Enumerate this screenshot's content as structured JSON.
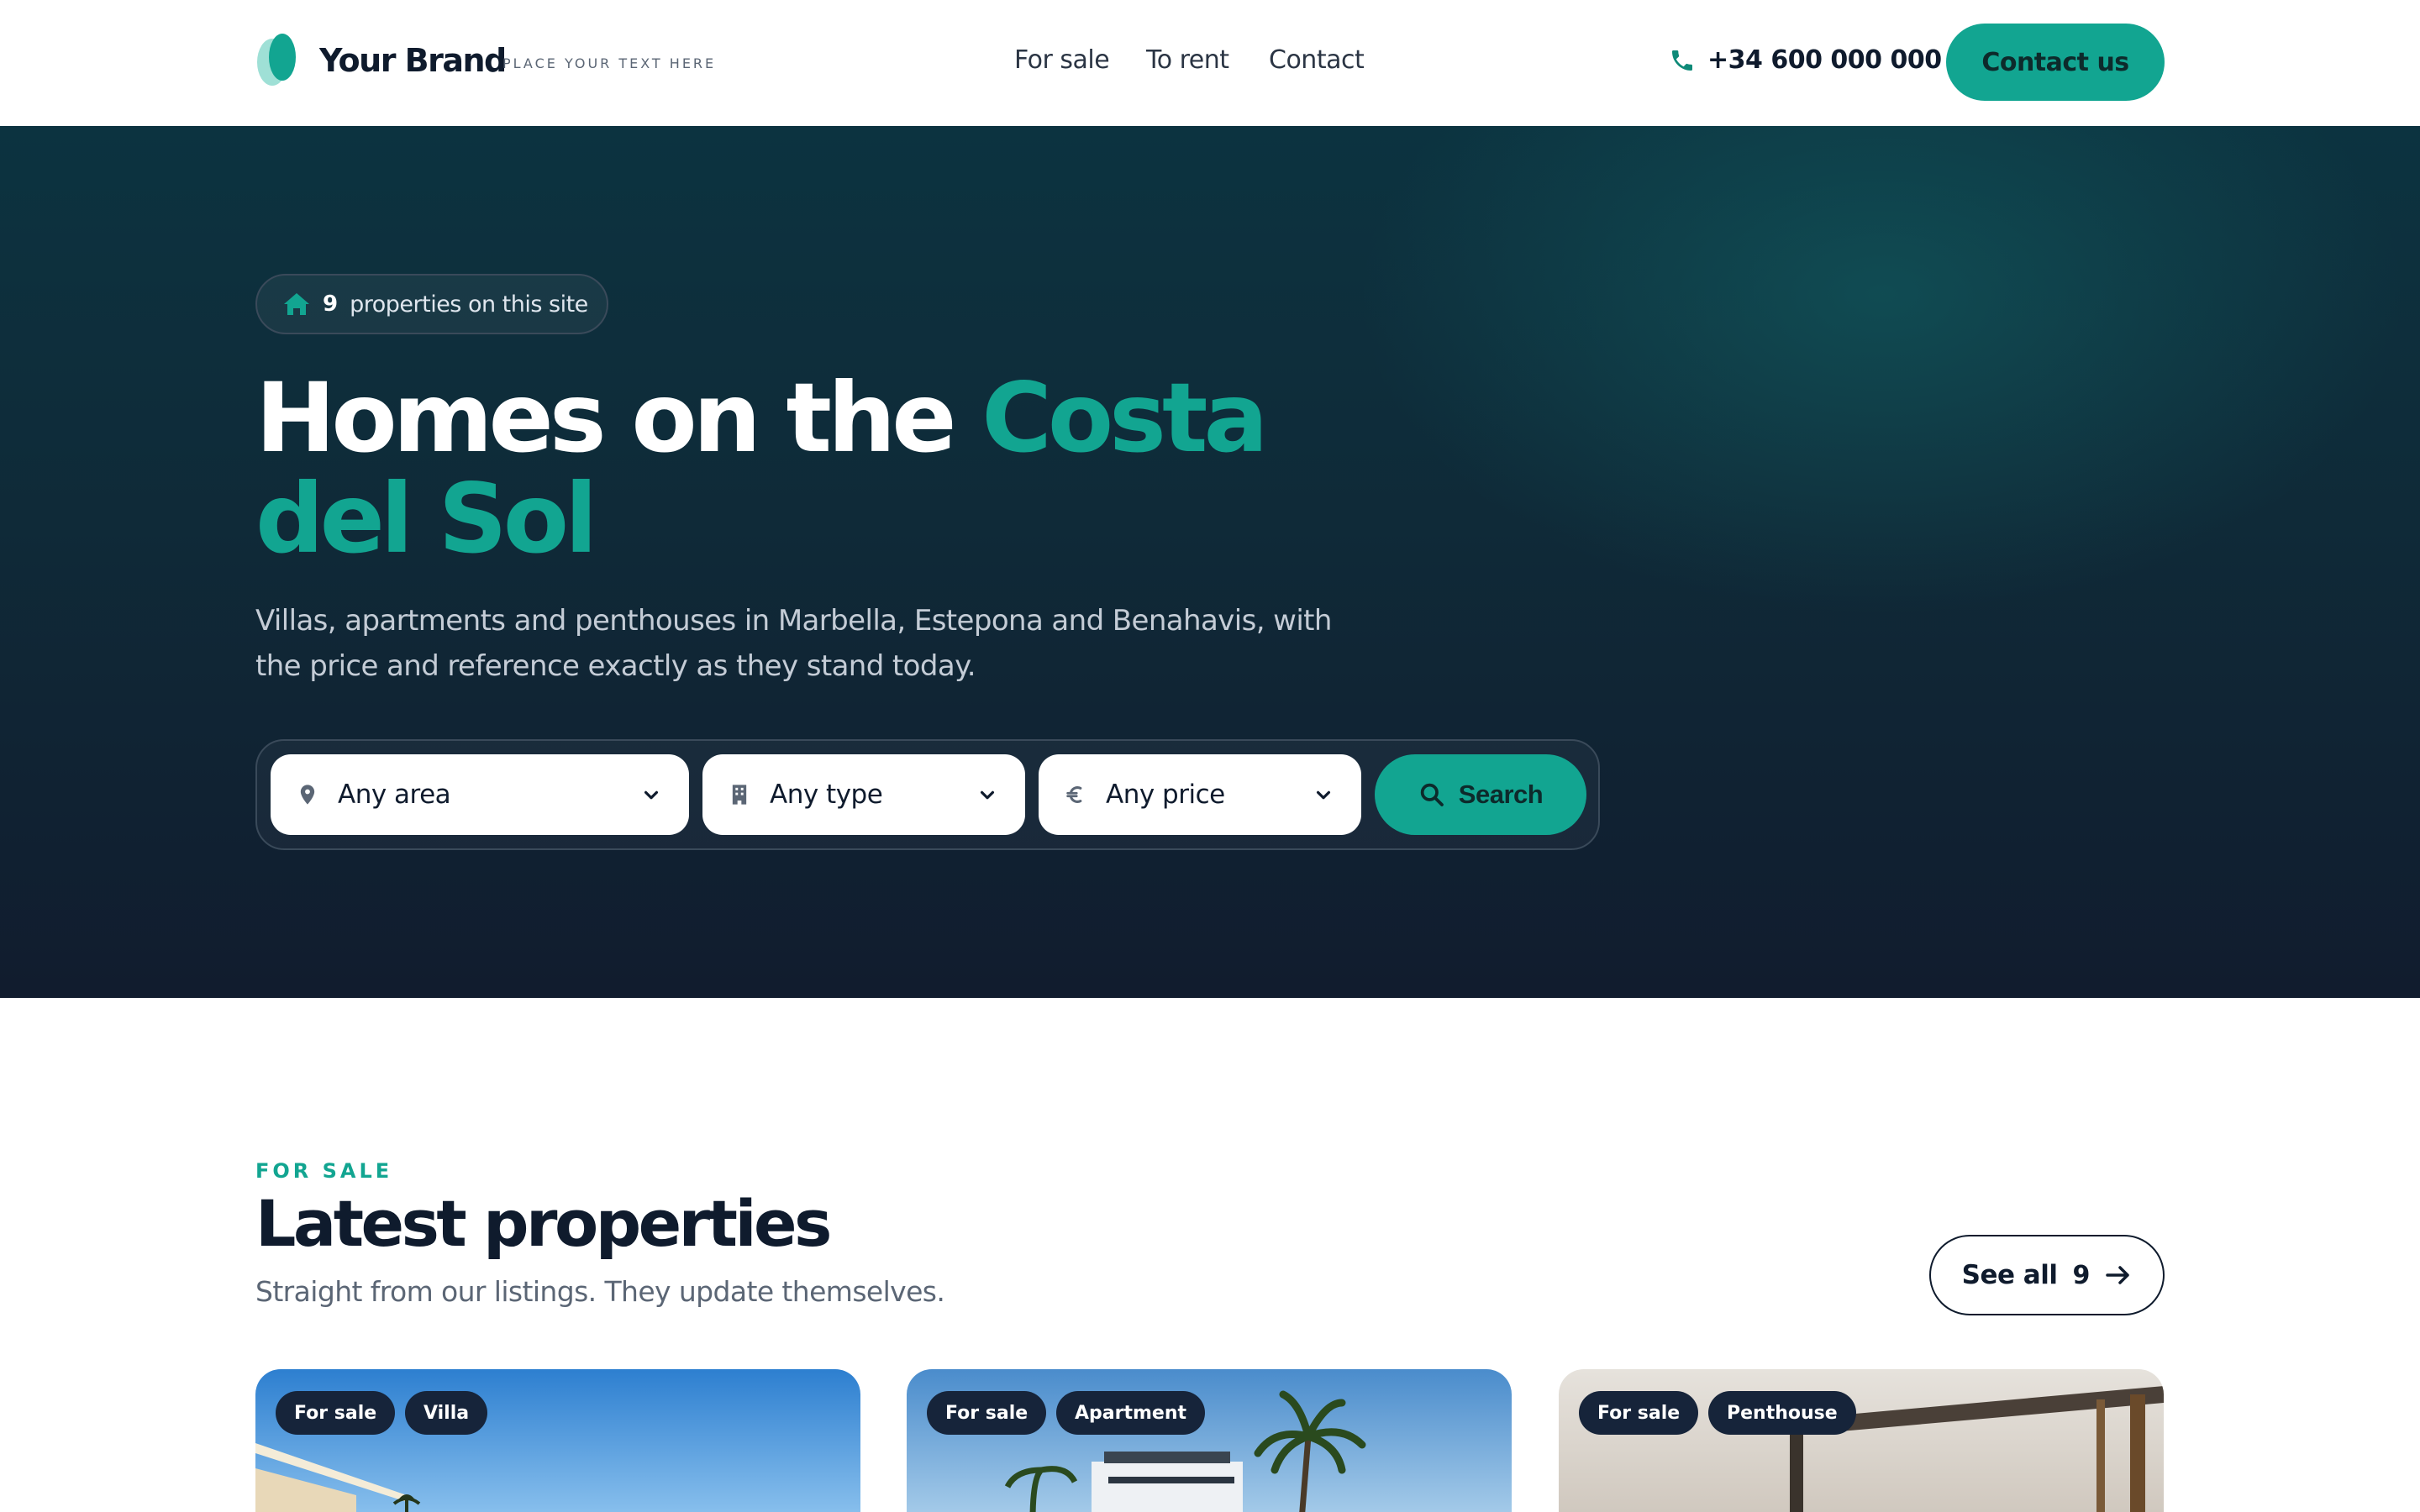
{
  "header": {
    "brand_name": "Your Brand",
    "brand_tagline": "PLACE YOUR TEXT HERE",
    "nav": [
      "For sale",
      "To rent",
      "Contact"
    ],
    "phone": "+34 600 000 000",
    "cta": "Contact us"
  },
  "hero": {
    "count": "9",
    "count_text": "properties on this site",
    "title_main": "Homes on the ",
    "title_accent": "Costa del Sol",
    "subtitle": "Villas, apartments and penthouses in Marbella, Estepona and Benahavis, with the price and reference exactly as they stand today.",
    "search": {
      "area": "Any area",
      "type": "Any type",
      "price": "Any price",
      "button": "Search"
    }
  },
  "listings": {
    "kicker": "FOR SALE",
    "title": "Latest properties",
    "subtitle": "Straight from our listings. They update themselves.",
    "see_all": "See all",
    "see_all_count": "9",
    "cards": [
      {
        "status": "For sale",
        "type": "Villa"
      },
      {
        "status": "For sale",
        "type": "Apartment"
      },
      {
        "status": "For sale",
        "type": "Penthouse"
      }
    ]
  },
  "colors": {
    "accent": "#12a591",
    "hero_dark": "#111c2e",
    "text_dark": "#0f1b2d"
  },
  "icons": [
    "brand-logo",
    "phone-icon",
    "home-icon",
    "location-pin-icon",
    "building-icon",
    "euro-icon",
    "chevron-down-icon",
    "search-icon",
    "arrow-right-icon"
  ]
}
